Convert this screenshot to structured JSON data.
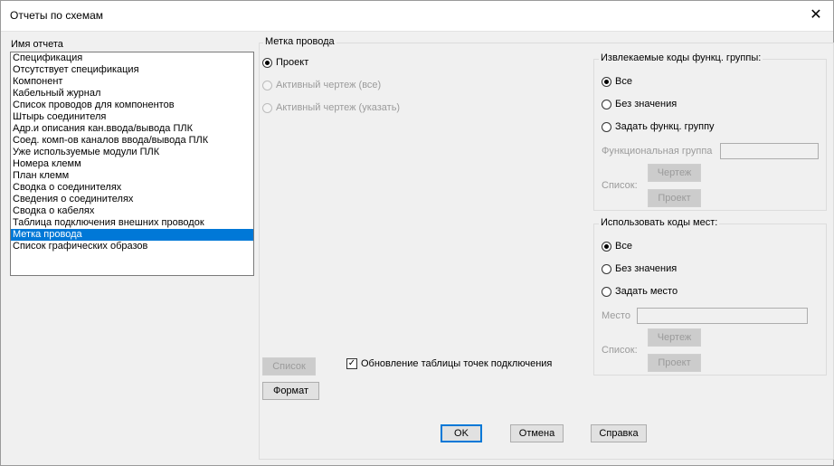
{
  "dialog": {
    "title": "Отчеты по схемам",
    "close_glyph": "✕"
  },
  "report_list": {
    "label": "Имя отчета",
    "items": [
      "Спецификация",
      "Отсутствует спецификация",
      "Компонент",
      "Кабельный журнал",
      "Список проводов для компонентов",
      "Штырь соединителя",
      "Адр.и описания кан.ввода/вывода ПЛК",
      "Соед. комп-ов каналов ввода/вывода ПЛК",
      "Уже используемые модули ПЛК",
      "Номера клемм",
      "План клемм",
      "Сводка о соединителях",
      "Сведения о соединителях",
      "Сводка о кабелях",
      "Таблица подключения внешних проводок",
      "Метка провода",
      "Список графических образов"
    ],
    "selected_index": 15
  },
  "wire_label_group": {
    "label": "Метка провода",
    "options": [
      "Проект",
      "Активный чертеж (все)",
      "Активный чертеж (указать)"
    ],
    "selected": 0
  },
  "func_group": {
    "label": "Извлекаемые коды функц. группы:",
    "options": [
      "Все",
      "Без значения",
      "Задать функц. группу"
    ],
    "selected": 0,
    "field_label": "Функциональная группа",
    "field_value": "",
    "list_label": "Список:",
    "drawing_button": "Чертеж",
    "project_button": "Проект"
  },
  "location": {
    "label": "Использовать коды мест:",
    "options": [
      "Все",
      "Без значения",
      "Задать место"
    ],
    "selected": 0,
    "field_label": "Место",
    "field_value": "",
    "list_label": "Список:",
    "drawing_button": "Чертеж",
    "project_button": "Проект"
  },
  "bottom": {
    "list_button": "Список",
    "format_button": "Формат",
    "update_checkbox_label": "Обновление таблицы точек подключения",
    "update_checked": true,
    "ok": "OK",
    "cancel": "Отмена",
    "help": "Справка"
  }
}
